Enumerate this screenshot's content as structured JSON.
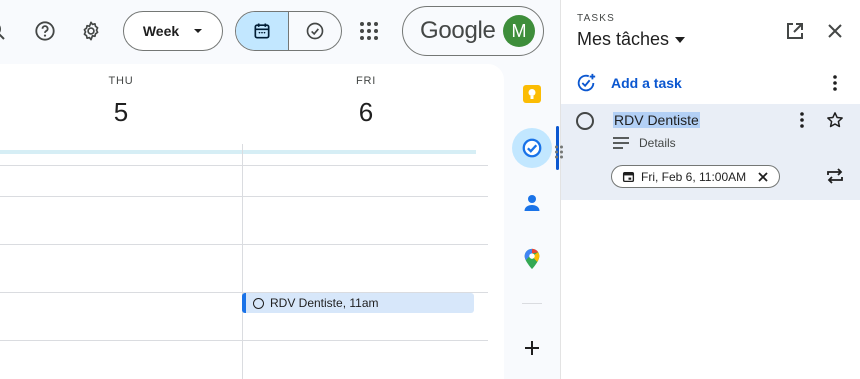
{
  "header": {
    "view_select": "Week",
    "brand": "Google",
    "avatar_initial": "M"
  },
  "calendar": {
    "days": [
      {
        "name": "THU",
        "number": "5"
      },
      {
        "name": "FRI",
        "number": "6"
      }
    ],
    "event": {
      "title": "RDV Dentiste",
      "time": ", 11am"
    }
  },
  "tasks": {
    "label": "TASKS",
    "list_name": "Mes tâches",
    "add_label": "Add a task",
    "items": [
      {
        "title": "RDV Dentiste",
        "details_label": "Details",
        "due": "Fri, Feb 6, 11:00AM"
      }
    ]
  },
  "colors": {
    "accent": "#0b57d0",
    "selected_bg": "#c2e7ff",
    "event_bg": "#d7e7fa",
    "avatar_bg": "#3e8e3b"
  }
}
